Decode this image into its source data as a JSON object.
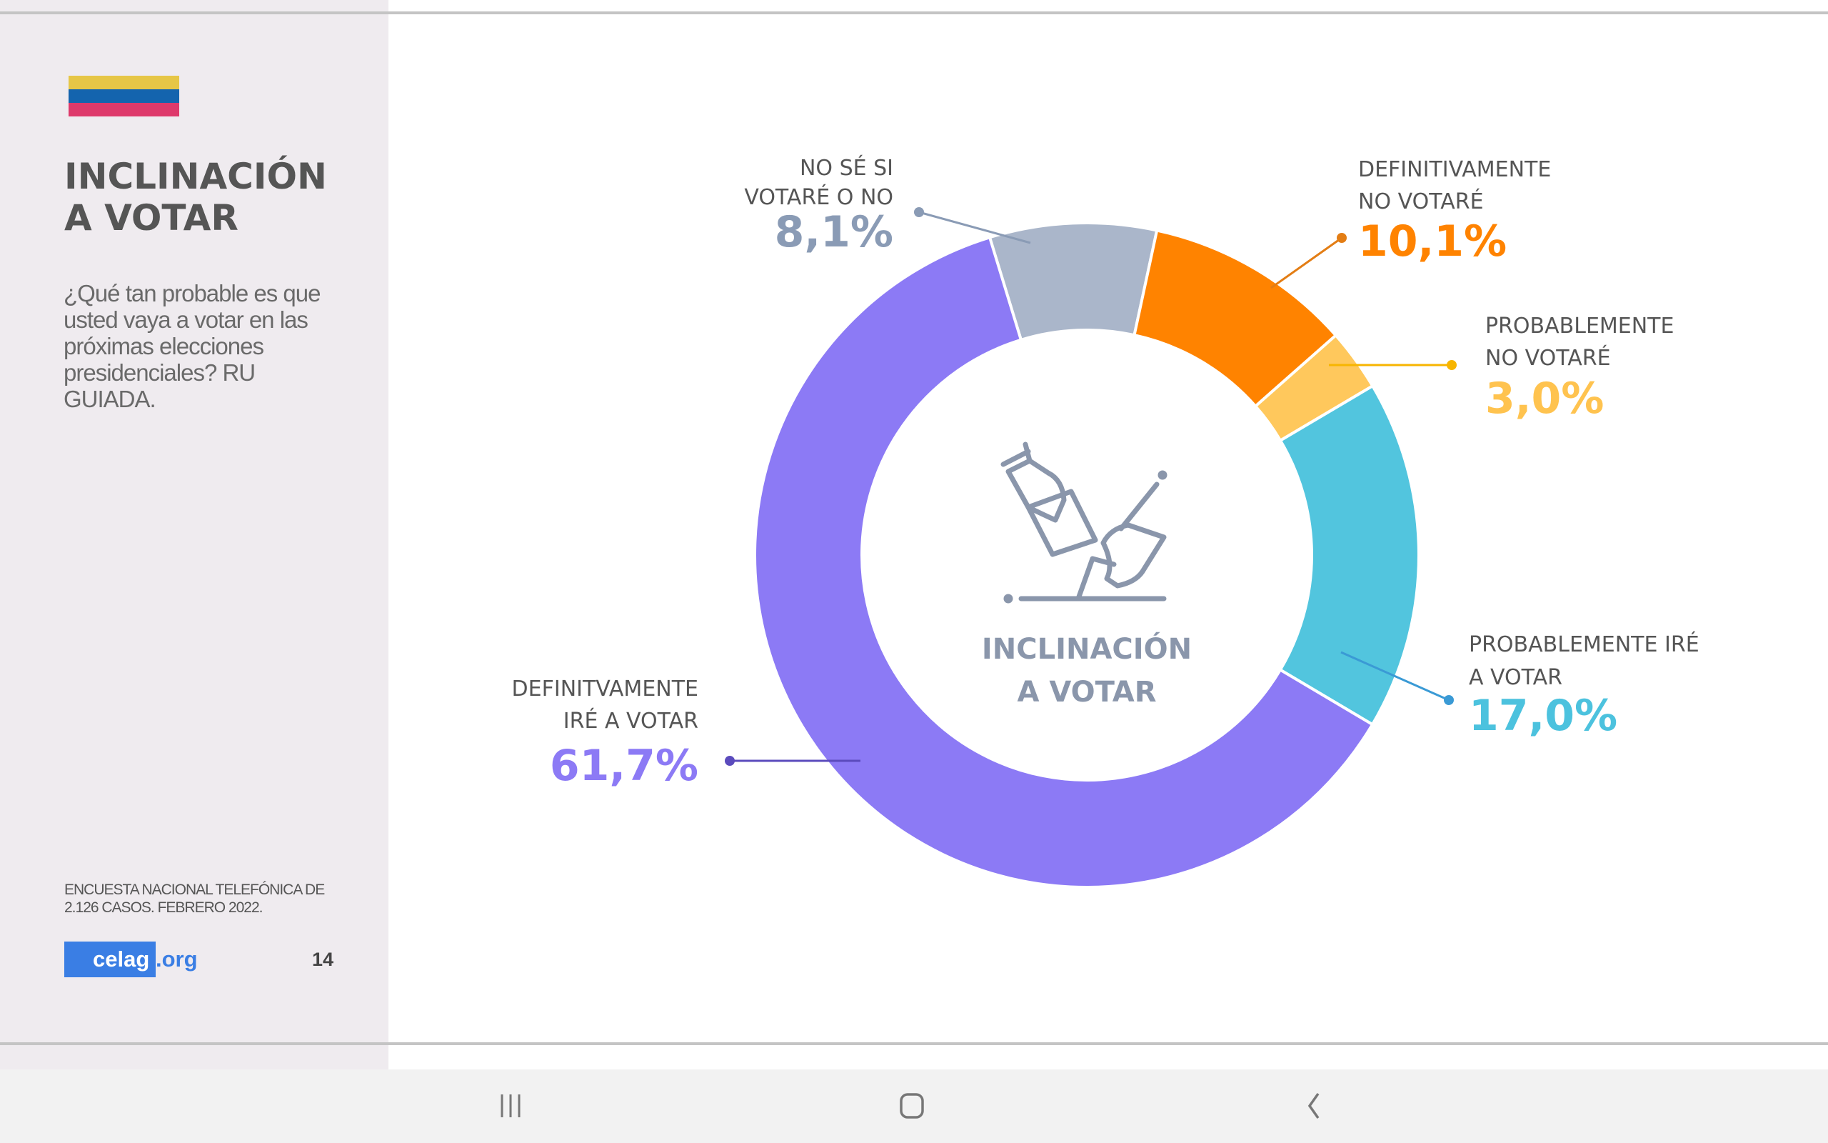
{
  "sidebar": {
    "flag_colors": [
      "#e6c646",
      "#1464ae",
      "#de396b"
    ],
    "title_line1": "INCLINACIÓN",
    "title_line2": "A VOTAR",
    "question": "¿Qué tan probable es que usted vaya a votar en las próximas elecciones presidenciales? RU GUIADA.",
    "source_line1": "ENCUESTA NACIONAL TELEFÓNICA DE",
    "source_line2": "2.126 CASOS. FEBRERO 2022.",
    "logo_part1": "celag",
    "logo_part2": ".org",
    "page_number": "14"
  },
  "chart_data": {
    "type": "donut",
    "center_label_line1": "INCLINACIÓN",
    "center_label_line2": "A VOTAR",
    "center_icon": "ballot-box-voting-icon",
    "slices": [
      {
        "label_lines": [
          "NO SÉ SI",
          "VOTARÉ O NO"
        ],
        "value": 8.1,
        "value_label": "8,1%",
        "color": "#aab6ca",
        "text_color": "#8a9bb5"
      },
      {
        "label_lines": [
          "DEFINITIVAMENTE",
          "NO VOTARÉ"
        ],
        "value": 10.1,
        "value_label": "10,1%",
        "color": "#ff8300",
        "text_color": "#ff8300"
      },
      {
        "label_lines": [
          "PROBABLEMENTE",
          "NO VOTARÉ"
        ],
        "value": 3.0,
        "value_label": "3,0%",
        "color": "#ffc85c",
        "text_color": "#ffc34f"
      },
      {
        "label_lines": [
          "PROBABLEMENTE IRÉ",
          "A VOTAR"
        ],
        "value": 17.0,
        "value_label": "17,0%",
        "color": "#52c5de",
        "text_color": "#4cc2de"
      },
      {
        "label_lines": [
          "DEFINITVAMENTE",
          "IRÉ A VOTAR"
        ],
        "value": 61.7,
        "value_label": "61,7%",
        "color": "#8c7af5",
        "text_color": "#8c7af5"
      }
    ]
  },
  "navbar": {
    "recent_icon": "recent-apps-icon",
    "home_icon": "home-icon",
    "back_icon": "back-icon"
  }
}
